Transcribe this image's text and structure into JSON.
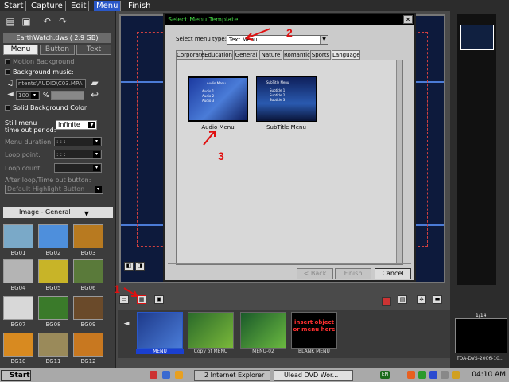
{
  "top_menu": {
    "items": [
      {
        "label": "Start",
        "active": false
      },
      {
        "label": "Capture",
        "active": false
      },
      {
        "label": "Edit",
        "active": false
      },
      {
        "label": "Menu",
        "active": true
      },
      {
        "label": "Finish",
        "active": false
      }
    ]
  },
  "left_panel": {
    "file_info": "EarthWatch.dws ( 2.9 GB)",
    "tabs": [
      {
        "label": "Menu",
        "active": true
      },
      {
        "label": "Button",
        "active": false
      },
      {
        "label": "Text",
        "active": false
      }
    ],
    "motion_background_label": "Motion Background",
    "background_music_label": "Background music:",
    "music_path": "ntents\\AUDIO\\C03.MPA",
    "volume_value": "100",
    "volume_unit": "%",
    "solid_bg_label": "Solid Background Color",
    "still_menu_label_1": "Still menu",
    "still_menu_label_2": "time out period:",
    "still_menu_value": "Infinite",
    "menu_duration_label": "Menu duration:",
    "loop_point_label": "Loop point:",
    "loop_count_label": "Loop count:",
    "after_loop_label": "After loop/Time out button:",
    "highlight_value": "Default Highlight Button",
    "gallery_title": "Image - General",
    "thumbs": [
      {
        "label": "BG01",
        "color": "#7aa9c8"
      },
      {
        "label": "BG02",
        "color": "#4e8fdc"
      },
      {
        "label": "BG03",
        "color": "#b87a20"
      },
      {
        "label": "BG04",
        "color": "#b4b4b4"
      },
      {
        "label": "BG05",
        "color": "#c8b428"
      },
      {
        "label": "BG06",
        "color": "#5a7a3a"
      },
      {
        "label": "BG07",
        "color": "#d8d8d8"
      },
      {
        "label": "BG08",
        "color": "#3a7a2a"
      },
      {
        "label": "BG09",
        "color": "#6a4a2a"
      },
      {
        "label": "BG10",
        "color": "#d88a20"
      },
      {
        "label": "BG11",
        "color": "#9a8a5a"
      },
      {
        "label": "BG12",
        "color": "#c87820"
      }
    ]
  },
  "dialog": {
    "title": "Select Menu Template",
    "close_glyph": "×",
    "menu_type_label": "Select menu type:",
    "menu_type_value": "Text Menu",
    "tabs": [
      {
        "label": "Corporate",
        "active": false
      },
      {
        "label": "Education",
        "active": false
      },
      {
        "label": "General",
        "active": false
      },
      {
        "label": "Nature",
        "active": false
      },
      {
        "label": "Romantic",
        "active": false
      },
      {
        "label": "Sports",
        "active": false
      },
      {
        "label": "Language",
        "active": true
      }
    ],
    "templates": [
      {
        "label": "Audio Menu",
        "selected": true
      },
      {
        "label": "SubTitle Menu",
        "selected": false
      }
    ],
    "audio_thumb_title": "Audio Menu",
    "audio_thumb_items": [
      "Audio 1",
      "Audio 2",
      "Audio 3"
    ],
    "subtitle_thumb_title": "SubTitle Menu",
    "subtitle_thumb_items": [
      "Subtitle 1",
      "Subtitle 2",
      "Subtitle 3"
    ],
    "buttons": {
      "back": "< Back",
      "finish": "Finish",
      "cancel": "Cancel"
    }
  },
  "annotations": [
    "1",
    "2",
    "3"
  ],
  "filmstrip": {
    "items": [
      {
        "label": "MENU",
        "selected": true
      },
      {
        "label": "Copy of MENU",
        "selected": false
      },
      {
        "label": "MENU-02",
        "selected": false
      },
      {
        "label": "BLANK MENU",
        "selected": false
      }
    ],
    "blank_text": "insert object or menu here",
    "badge": "1"
  },
  "right_panel": {
    "page_counter": "1/14",
    "clip_label": "TDA-DVS-2006-10..."
  },
  "taskbar": {
    "start": "Start",
    "buttons": [
      "2 Internet Explorer",
      "Ulead DVD Wor..."
    ],
    "lang": "EN",
    "clock": "04:10 AM"
  },
  "colors": {
    "accent_blue": "#2a58c8",
    "annotation_red": "#e01010",
    "dialog_title_green": "#46d846"
  }
}
